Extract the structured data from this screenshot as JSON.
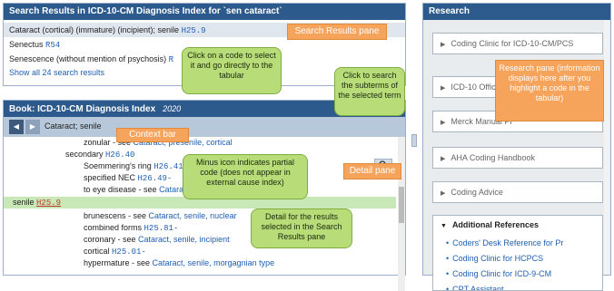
{
  "search": {
    "title": "Search Results in ICD-10-CM Diagnosis Index for `sen cataract`",
    "results": [
      {
        "text": "Cataract (cortical) (immature) (incipient); senile",
        "code": "H25.9",
        "selected": true
      },
      {
        "text": "Senectus",
        "code": "R54",
        "selected": false
      },
      {
        "text": "Senescence (without mention of psychosis)",
        "code": "R",
        "selected": false
      }
    ],
    "show_all": "Show all 24 search results"
  },
  "book": {
    "title": "Book: ICD-10-CM Diagnosis Index",
    "year": "2020",
    "context_text": "Cataract; senile",
    "entries": [
      {
        "prefix": "zonular - see ",
        "link": "Cataract, presenile, cortical",
        "code": ""
      },
      {
        "prefix": "secondary ",
        "link": "",
        "code": "H26.40"
      },
      {
        "prefix": "Soemmering's ring ",
        "link": "",
        "code": "H26.41-"
      },
      {
        "prefix": "specified NEC ",
        "link": "",
        "code": "H26.49-"
      },
      {
        "prefix": "to eye disease - see ",
        "link": "Cataract, complicated",
        "code": ""
      },
      {
        "prefix": "senile ",
        "link": "",
        "code": "H25.9"
      },
      {
        "prefix": "brunescens - see ",
        "link": "Cataract, senile, nuclear",
        "code": ""
      },
      {
        "prefix": "combined forms ",
        "link": "",
        "code": "H25.81-"
      },
      {
        "prefix": "coronary - see ",
        "link": "Cataract, senile, incipient",
        "code": ""
      },
      {
        "prefix": "cortical ",
        "link": "",
        "code": "H25.01-"
      },
      {
        "prefix": "hypermature - see ",
        "link": "Cataract, senile, morgagnian type",
        "code": ""
      }
    ]
  },
  "research": {
    "title": "Research",
    "items": [
      "Coding Clinic for ICD-10-CM/PCS",
      "ICD-10 Official G",
      "Merck Manual Pr",
      "AHA Coding Handbook",
      "Coding Advice"
    ],
    "additional": {
      "title": "Additional References",
      "links": [
        "Coders' Desk Reference for Pr",
        "Coding Clinic for HCPCS",
        "Coding Clinic for ICD-9-CM",
        "CPT Assistant"
      ]
    }
  },
  "callouts": {
    "search_results_pane": "Search Results pane",
    "click_code": "Click on a code to select it and go directly to the tabular",
    "click_search": "Click to search the subterms of the selected term",
    "research_pane": "Research pane (information displays here after you highlight a code in the tabular)",
    "context_bar": "Context bar",
    "minus_icon": "Minus icon indicates partial code (does not appear in external cause index)",
    "detail_pane": "Detail pane",
    "detail_results": "Detail for the results selected in the Search Results pane"
  },
  "icons": {
    "back": "back-arrow-icon",
    "forward": "forward-arrow-icon",
    "search": "magnifier-icon"
  }
}
